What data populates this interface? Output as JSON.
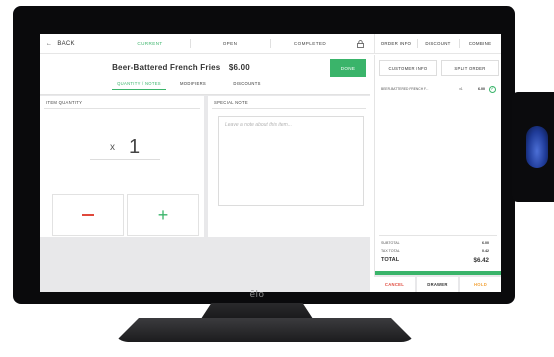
{
  "brand": "ēlo",
  "colors": {
    "accent": "#3ab46a",
    "danger": "#e0483b",
    "warning": "#f2a33a"
  },
  "topbar": {
    "back_label": "BACK",
    "tabs": [
      {
        "label": "CURRENT",
        "active": true
      },
      {
        "label": "OPEN",
        "active": false
      },
      {
        "label": "COMPLETED",
        "active": false
      }
    ],
    "right_tabs": [
      "ORDER INFO",
      "DISCOUNT",
      "COMBINE"
    ]
  },
  "item": {
    "name": "Beer-Battered French Fries",
    "price": "$6.00",
    "done_label": "DONE",
    "sub_tabs": [
      {
        "label": "QUANTITY / NOTES",
        "active": true
      },
      {
        "label": "MODIFIERS",
        "active": false
      },
      {
        "label": "DISCOUNTS",
        "active": false
      }
    ]
  },
  "quantity": {
    "label": "ITEM QUANTITY",
    "multiplier": "x",
    "value": "1",
    "minus_icon": "minus-icon",
    "plus_icon": "plus-icon"
  },
  "note": {
    "label": "SPECIAL NOTE",
    "placeholder": "Leave a note about this item..."
  },
  "order": {
    "customer_label": "CUSTOMER INFO",
    "split_label": "SPLIT ORDER",
    "line_items": [
      {
        "name": "BEER-BATTERED FRENCH F...",
        "at": "x1",
        "price": "6.00"
      }
    ],
    "totals": {
      "subtotal_label": "SUBTOTAL",
      "subtotal": "6.00",
      "tax_label": "TAX TOTAL",
      "tax": "0.42",
      "total_label": "TOTAL",
      "total": "$6.42"
    },
    "checkout_label": "CHECKOUT",
    "cancel_label": "CANCEL",
    "drawer_label": "DRAWER",
    "hold_label": "HOLD"
  }
}
